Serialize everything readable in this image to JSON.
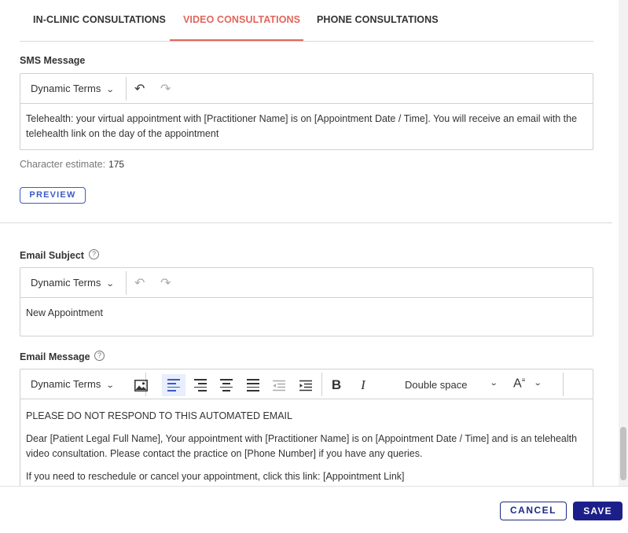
{
  "tabs": [
    {
      "label": "IN-CLINIC CONSULTATIONS"
    },
    {
      "label": "VIDEO CONSULTATIONS"
    },
    {
      "label": "PHONE CONSULTATIONS"
    }
  ],
  "active_tab": "VIDEO CONSULTATIONS",
  "sms": {
    "label": "SMS Message",
    "dynamic_terms": "Dynamic Terms",
    "content": "Telehealth: your virtual appointment with [Practitioner Name] is on [Appointment Date / Time]. You will receive an email with the telehealth link on the day of the appointment",
    "char_estimate_label": "Character estimate:",
    "char_estimate_value": "175",
    "preview_label": "PREVIEW"
  },
  "email_subject": {
    "label": "Email Subject",
    "dynamic_terms": "Dynamic Terms",
    "content": "New Appointment"
  },
  "email_message": {
    "label": "Email Message",
    "dynamic_terms": "Dynamic Terms",
    "spacing_value": "Double space",
    "paragraphs": [
      "PLEASE DO NOT RESPOND TO THIS AUTOMATED EMAIL",
      "Dear [Patient Legal Full Name], Your appointment with [Practitioner Name] is on [Appointment Date / Time] and is an telehealth video consultation. Please contact the practice on [Phone Number] if you have any queries.",
      "If you need to reschedule or cancel your appointment, click this link: [Appointment Link]"
    ]
  },
  "footer": {
    "cancel_label": "CANCEL",
    "save_label": "SAVE"
  },
  "colors": {
    "active_tab": "#e2665b",
    "primary": "#1c1f8a",
    "preview": "#3a5bc7"
  }
}
